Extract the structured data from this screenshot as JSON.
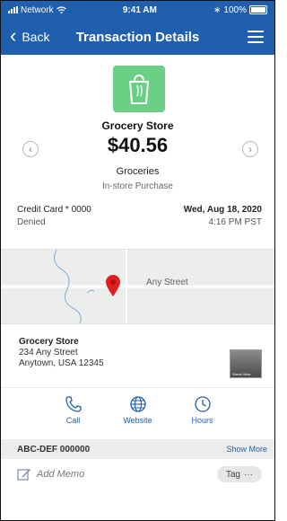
{
  "status_bar": {
    "carrier": "Network",
    "time": "9:41 AM",
    "battery": "100%"
  },
  "nav": {
    "back_label": "Back",
    "title": "Transaction Details"
  },
  "transaction": {
    "merchant": "Grocery Store",
    "amount": "$40.56",
    "category": "Groceries",
    "purchase_type": "In-store Purchase",
    "card": "Credit Card * 0000",
    "status": "Denied",
    "date": "Wed, Aug 18, 2020",
    "time": "4:16 PM PST"
  },
  "map": {
    "street_label": "Any Street",
    "pin_color": "#e02020"
  },
  "address": {
    "name": "Grocery Store",
    "line1": "234 Any Street",
    "line2": "Anytown, USA 12345",
    "street_view_label": "Street View"
  },
  "actions": [
    {
      "label": "Call",
      "icon": "phone-icon"
    },
    {
      "label": "Website",
      "icon": "globe-icon"
    },
    {
      "label": "Hours",
      "icon": "clock-icon"
    }
  ],
  "reference": {
    "id": "ABC-DEF 000000",
    "show_more": "Show More"
  },
  "memo": {
    "add_memo": "Add Memo",
    "tag_label": "Tag",
    "tag_more": "···"
  },
  "colors": {
    "brand_blue": "#1f5fae",
    "merchant_tile": "#6ccf86"
  }
}
